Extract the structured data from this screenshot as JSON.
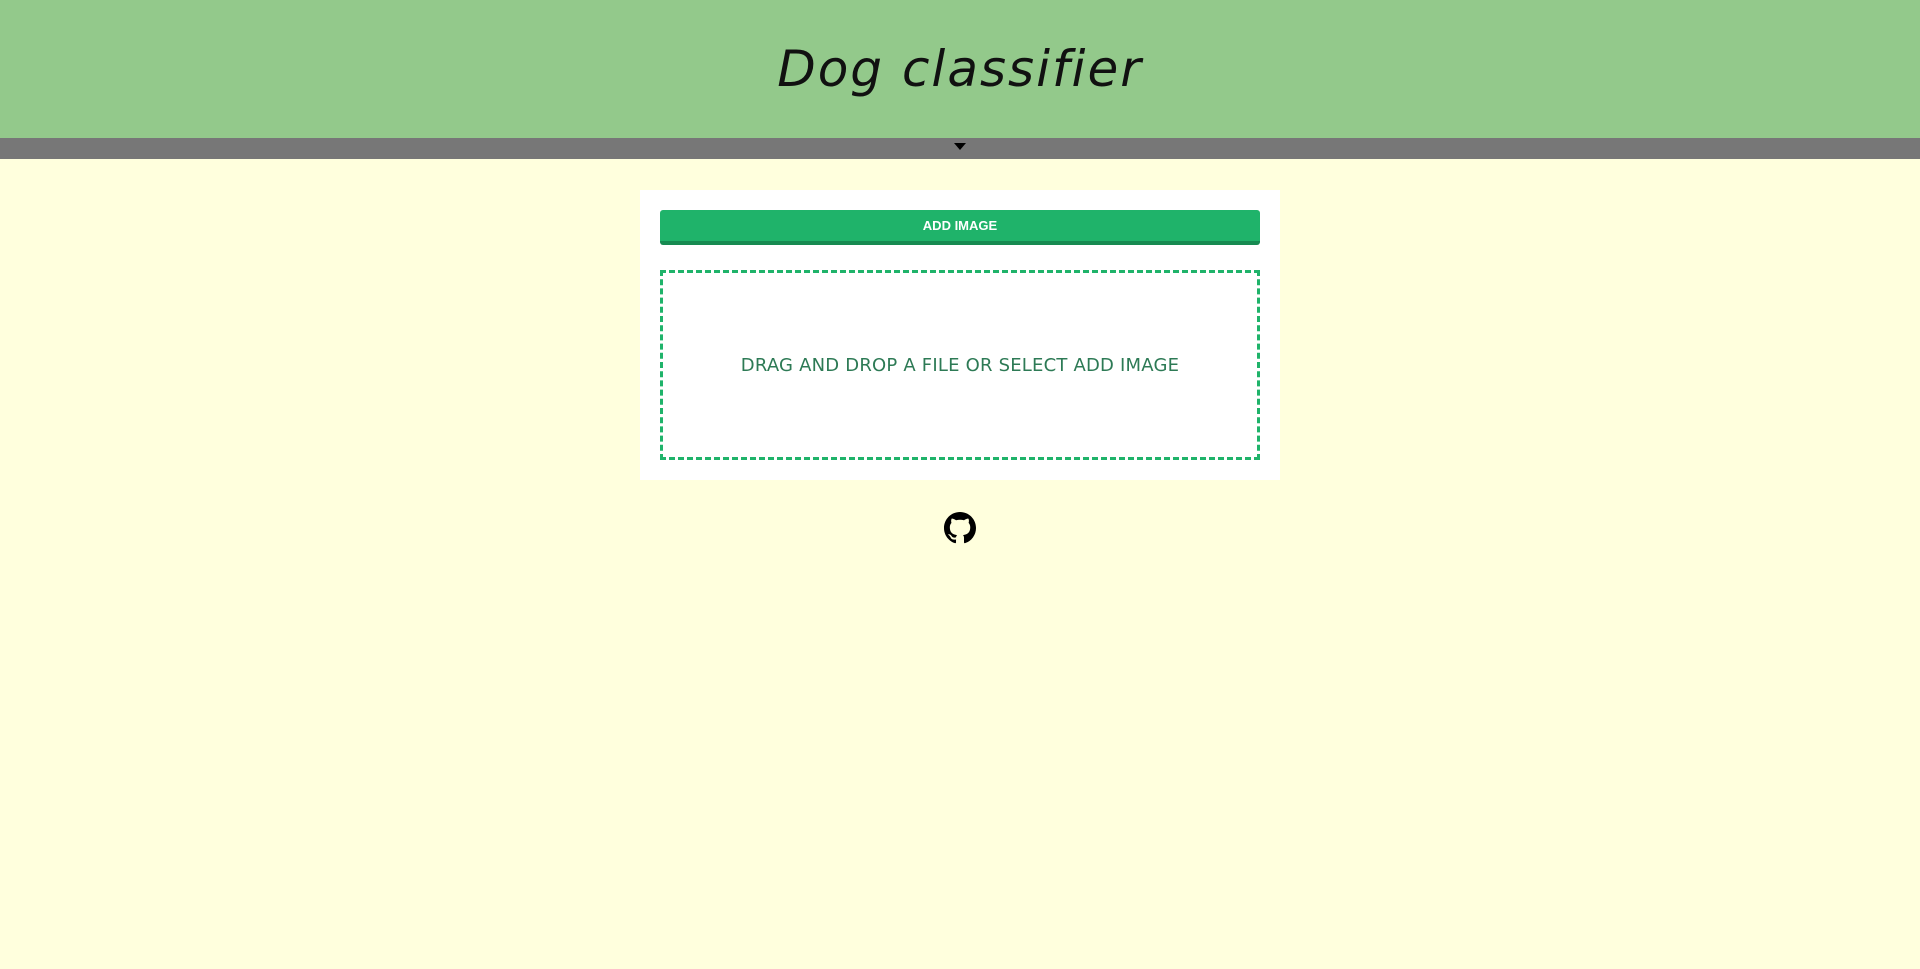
{
  "header": {
    "title": "Dog classifier",
    "background_color": "#93c98b"
  },
  "toggle_bar": {
    "icon": "caret-down-icon",
    "background_color": "#777777"
  },
  "upload": {
    "add_image_label": "ADD IMAGE",
    "dropzone_text": "DRAG AND DROP A FILE OR SELECT ADD IMAGE",
    "accent_color": "#1fb36a"
  },
  "footer": {
    "github_icon": "github-icon"
  },
  "page": {
    "background_color": "#ffffdd"
  }
}
